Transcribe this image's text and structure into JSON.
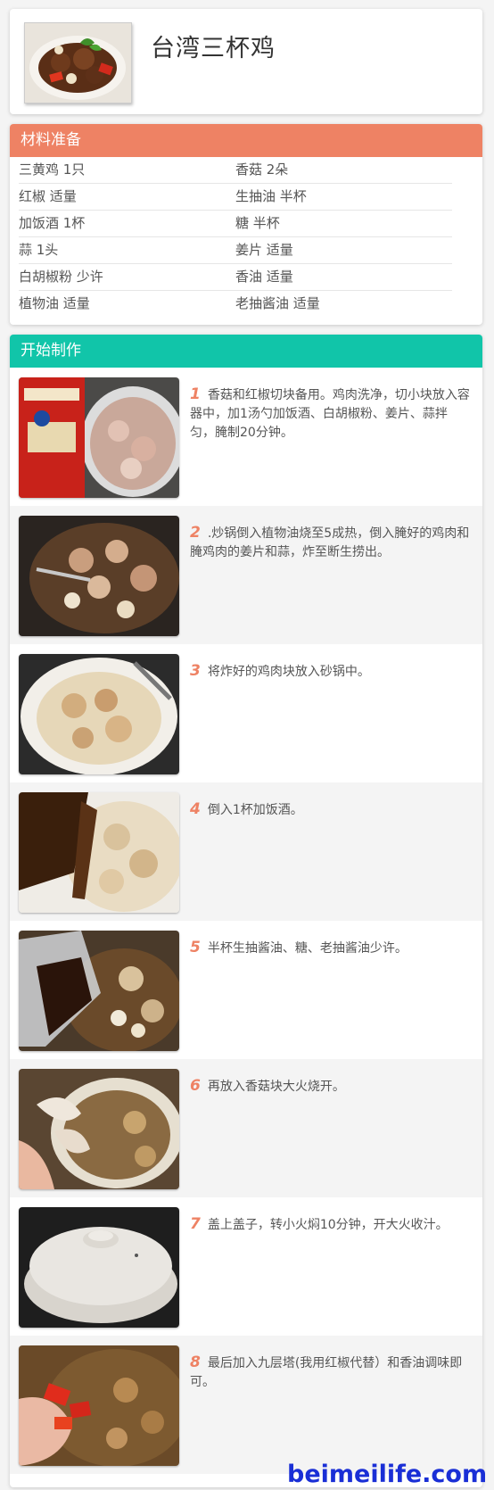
{
  "recipe": {
    "title": "台湾三杯鸡"
  },
  "ingredients": {
    "heading": "材料准备",
    "rows": [
      [
        "三黄鸡 1只",
        "香菇 2朵"
      ],
      [
        "红椒 适量",
        "生抽油 半杯"
      ],
      [
        "加饭酒 1杯",
        "糖 半杯"
      ],
      [
        "蒜 1头",
        "姜片 适量"
      ],
      [
        "白胡椒粉 少许",
        "香油 适量"
      ],
      [
        "植物油 适量",
        "老抽酱油 适量"
      ]
    ]
  },
  "steps": {
    "heading": "开始制作",
    "items": [
      {
        "num": "1",
        "text": "香菇和红椒切块备用。鸡肉洗净，切小块放入容器中，加1汤勺加饭酒、白胡椒粉、姜片、蒜拌匀，腌制20分钟。"
      },
      {
        "num": "2",
        "text": ".炒锅倒入植物油烧至5成热，倒入腌好的鸡肉和腌鸡肉的姜片和蒜，炸至断生捞出。"
      },
      {
        "num": "3",
        "text": "将炸好的鸡肉块放入砂锅中。"
      },
      {
        "num": "4",
        "text": "倒入1杯加饭酒。"
      },
      {
        "num": "5",
        "text": "半杯生抽酱油、糖、老抽酱油少许。"
      },
      {
        "num": "6",
        "text": "再放入香菇块大火烧开。"
      },
      {
        "num": "7",
        "text": "盖上盖子，转小火焖10分钟，开大火收汁。"
      },
      {
        "num": "8",
        "text": "最后加入九层塔(我用红椒代替）和香油调味即可。"
      }
    ]
  },
  "watermark": "beimeilife.com",
  "colors": {
    "ingredients_header": "#ee8264",
    "steps_header": "#11c5a9",
    "step_number": "#ee8264",
    "watermark": "#1a2fd6"
  }
}
